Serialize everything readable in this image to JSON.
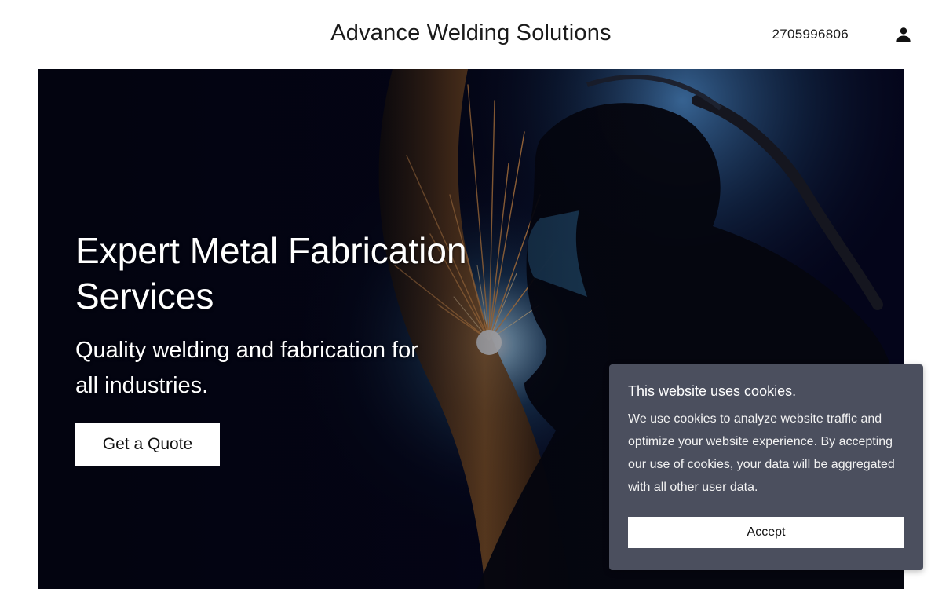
{
  "header": {
    "site_title": "Advance Welding Solutions",
    "phone": "2705996806",
    "account_icon": "user-icon"
  },
  "hero": {
    "title": "Expert Metal Fabrication Services",
    "subtitle": "Quality welding and fabrication for all industries.",
    "cta_label": "Get a Quote",
    "background_image": "welder-with-sparks"
  },
  "cookie_banner": {
    "title": "This website uses cookies.",
    "body": "We use cookies to analyze website traffic and optimize your website experience. By accepting our use of cookies, your data will be aggregated with all other user data.",
    "accept_label": "Accept"
  },
  "colors": {
    "hero_background": "#04051a",
    "cookie_background": "#4b4f5e",
    "button_background": "#ffffff",
    "text_dark": "#1a1a1a"
  }
}
